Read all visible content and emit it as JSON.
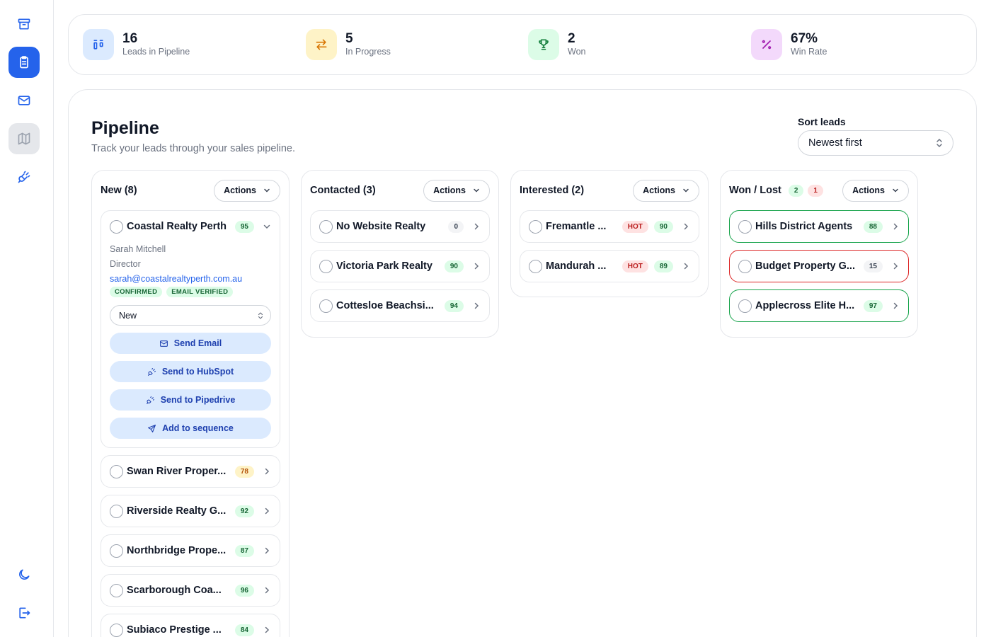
{
  "sidebar": {
    "items": [
      {
        "icon": "archive-icon"
      },
      {
        "icon": "clipboard-icon",
        "active": true
      },
      {
        "icon": "mail-icon"
      },
      {
        "icon": "map-icon"
      },
      {
        "icon": "plug-icon"
      },
      {
        "icon": "moon-icon"
      },
      {
        "icon": "logout-icon"
      }
    ]
  },
  "stats": [
    {
      "value": "16",
      "label": "Leads in Pipeline",
      "icon": "columns-icon",
      "bg": "#dbeafe",
      "fg": "#2563eb"
    },
    {
      "value": "5",
      "label": "In Progress",
      "icon": "swap-icon",
      "bg": "#fef3c7",
      "fg": "#d97706"
    },
    {
      "value": "2",
      "label": "Won",
      "icon": "trophy-icon",
      "bg": "#dcfce7",
      "fg": "#15803d"
    },
    {
      "value": "67%",
      "label": "Win Rate",
      "icon": "percent-icon",
      "bg": "#f3d9fb",
      "fg": "#a21caf"
    }
  ],
  "page": {
    "title": "Pipeline",
    "subtitle": "Track your leads through your sales pipeline.",
    "sort_label": "Sort leads",
    "sort_value": "Newest first"
  },
  "columns": [
    {
      "title": "New (8)",
      "actions": "Actions",
      "expanded": {
        "name": "Coastal Realty Perth",
        "score": "95",
        "contact": "Sarah Mitchell",
        "role": "Director",
        "email": "sarah@coastalrealtyperth.com.au",
        "tags": [
          "CONFIRMED",
          "EMAIL VERIFIED"
        ],
        "status": "New",
        "actions": [
          {
            "label": "Send Email",
            "icon": "mail-icon"
          },
          {
            "label": "Send to HubSpot",
            "icon": "plug-icon"
          },
          {
            "label": "Send to Pipedrive",
            "icon": "plug-icon"
          },
          {
            "label": "Add to sequence",
            "icon": "send-icon"
          }
        ]
      },
      "leads": [
        {
          "name": "Swan River Proper...",
          "score": "78",
          "tone": "yellow"
        },
        {
          "name": "Riverside Realty G...",
          "score": "92",
          "tone": "green"
        },
        {
          "name": "Northbridge Prope...",
          "score": "87",
          "tone": "green"
        },
        {
          "name": "Scarborough Coa...",
          "score": "96",
          "tone": "green"
        },
        {
          "name": "Subiaco Prestige ...",
          "score": "84",
          "tone": "green"
        }
      ]
    },
    {
      "title": "Contacted (3)",
      "actions": "Actions",
      "leads": [
        {
          "name": "No Website Realty",
          "score": "0",
          "tone": "gray"
        },
        {
          "name": "Victoria Park Realty",
          "score": "90",
          "tone": "green"
        },
        {
          "name": "Cottesloe Beachsi...",
          "score": "94",
          "tone": "green"
        }
      ]
    },
    {
      "title": "Interested (2)",
      "actions": "Actions",
      "leads": [
        {
          "name": "Fremantle ...",
          "hot": "HOT",
          "score": "90",
          "tone": "green"
        },
        {
          "name": "Mandurah ...",
          "hot": "HOT",
          "score": "89",
          "tone": "green"
        }
      ]
    },
    {
      "title": "Won / Lost",
      "won_count": "2",
      "lost_count": "1",
      "actions": "Actions",
      "leads": [
        {
          "name": "Hills District Agents",
          "score": "88",
          "tone": "green",
          "outcome": "won"
        },
        {
          "name": "Budget Property G...",
          "score": "15",
          "tone": "gray",
          "outcome": "lost"
        },
        {
          "name": "Applecross Elite H...",
          "score": "97",
          "tone": "green",
          "outcome": "won"
        }
      ]
    }
  ]
}
